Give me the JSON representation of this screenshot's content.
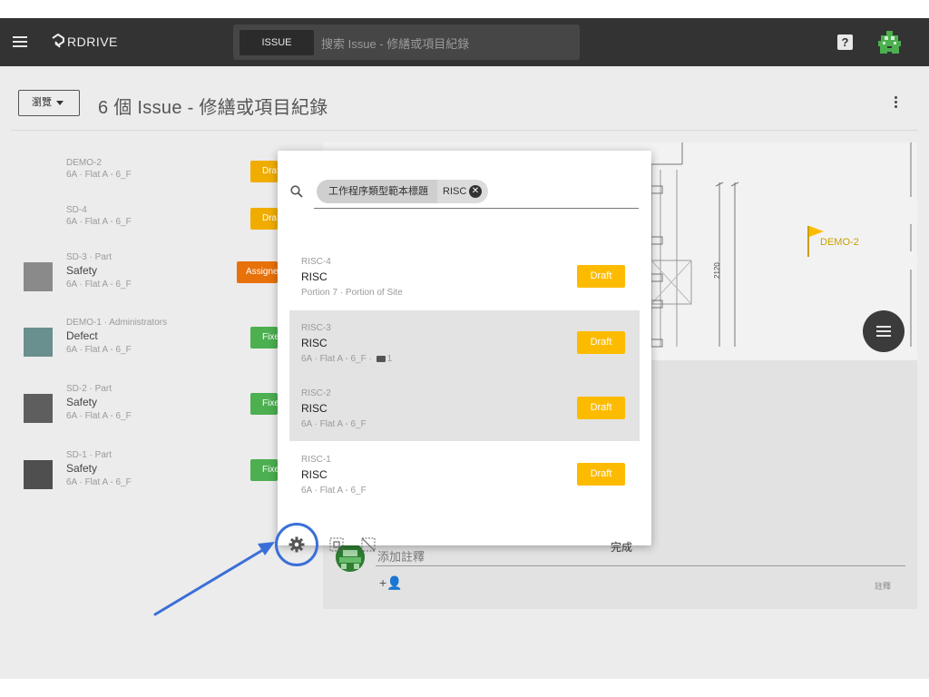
{
  "topbar": {
    "menu_icon": "hamburger-menu-icon",
    "logo_text": "RDRIVE",
    "search_type": "ISSUE",
    "search_placeholder": "搜索 Issue - 修繕或項目紀錄",
    "help_icon_text": "?"
  },
  "header": {
    "browse_label": "瀏覽",
    "title": "6 個 Issue - 修繕或項目紀錄"
  },
  "issues": [
    {
      "meta": "DEMO-2",
      "title": "",
      "sub": "6A · Flat A - 6_F",
      "badge": "Draft",
      "badge_color": "#f0ad00",
      "thumb": false
    },
    {
      "meta": "SD-4",
      "title": "",
      "sub": "6A · Flat A - 6_F",
      "badge": "Draft",
      "badge_color": "#f0ad00",
      "thumb": false
    },
    {
      "meta": "SD-3 · Part",
      "title": "Safety",
      "sub": "6A · Flat A - 6_F",
      "badge": "Assigned",
      "badge_color": "#e8710a",
      "thumb": true
    },
    {
      "meta": "DEMO-1 · Administrators",
      "title": "Defect",
      "sub": "6A · Flat A - 6_F",
      "badge": "Fixed",
      "badge_color": "#4caf50",
      "thumb": true
    },
    {
      "meta": "SD-2 · Part",
      "title": "Safety",
      "sub": "6A · Flat A - 6_F",
      "badge": "Fixed",
      "badge_color": "#4caf50",
      "thumb": true
    },
    {
      "meta": "SD-1 · Part",
      "title": "Safety",
      "sub": "6A · Flat A - 6_F",
      "badge": "Fixed",
      "badge_color": "#4caf50",
      "thumb": true
    }
  ],
  "plan": {
    "dimension_label": "2120",
    "flag_label": "DEMO-2"
  },
  "comment": {
    "placeholder": "添加註釋",
    "add_person_icon": "+👤",
    "submit_label": "註釋"
  },
  "dialog": {
    "filter_label": "工作程序類型範本標題",
    "filter_value": "RISC",
    "filter_clear": "✕",
    "rows": [
      {
        "id": "RISC-4",
        "title": "RISC",
        "sub": "Portion 7 · Portion of Site",
        "attachments": "",
        "badge": "Draft"
      },
      {
        "id": "RISC-3",
        "title": "RISC",
        "sub": "6A · Flat A - 6_F · ",
        "attachments": "1",
        "badge": "Draft"
      },
      {
        "id": "RISC-2",
        "title": "RISC",
        "sub": "6A · Flat A - 6_F",
        "attachments": "",
        "badge": "Draft"
      },
      {
        "id": "RISC-1",
        "title": "RISC",
        "sub": "6A · Flat A - 6_F",
        "attachments": "",
        "badge": "Draft"
      }
    ],
    "done_label": "完成",
    "footer_icons": [
      "gear-icon",
      "select-all-icon",
      "deselect-icon"
    ]
  },
  "colors": {
    "topbar": "#333333",
    "draft": "#fdbb00",
    "annotation": "#3a6fd8"
  }
}
